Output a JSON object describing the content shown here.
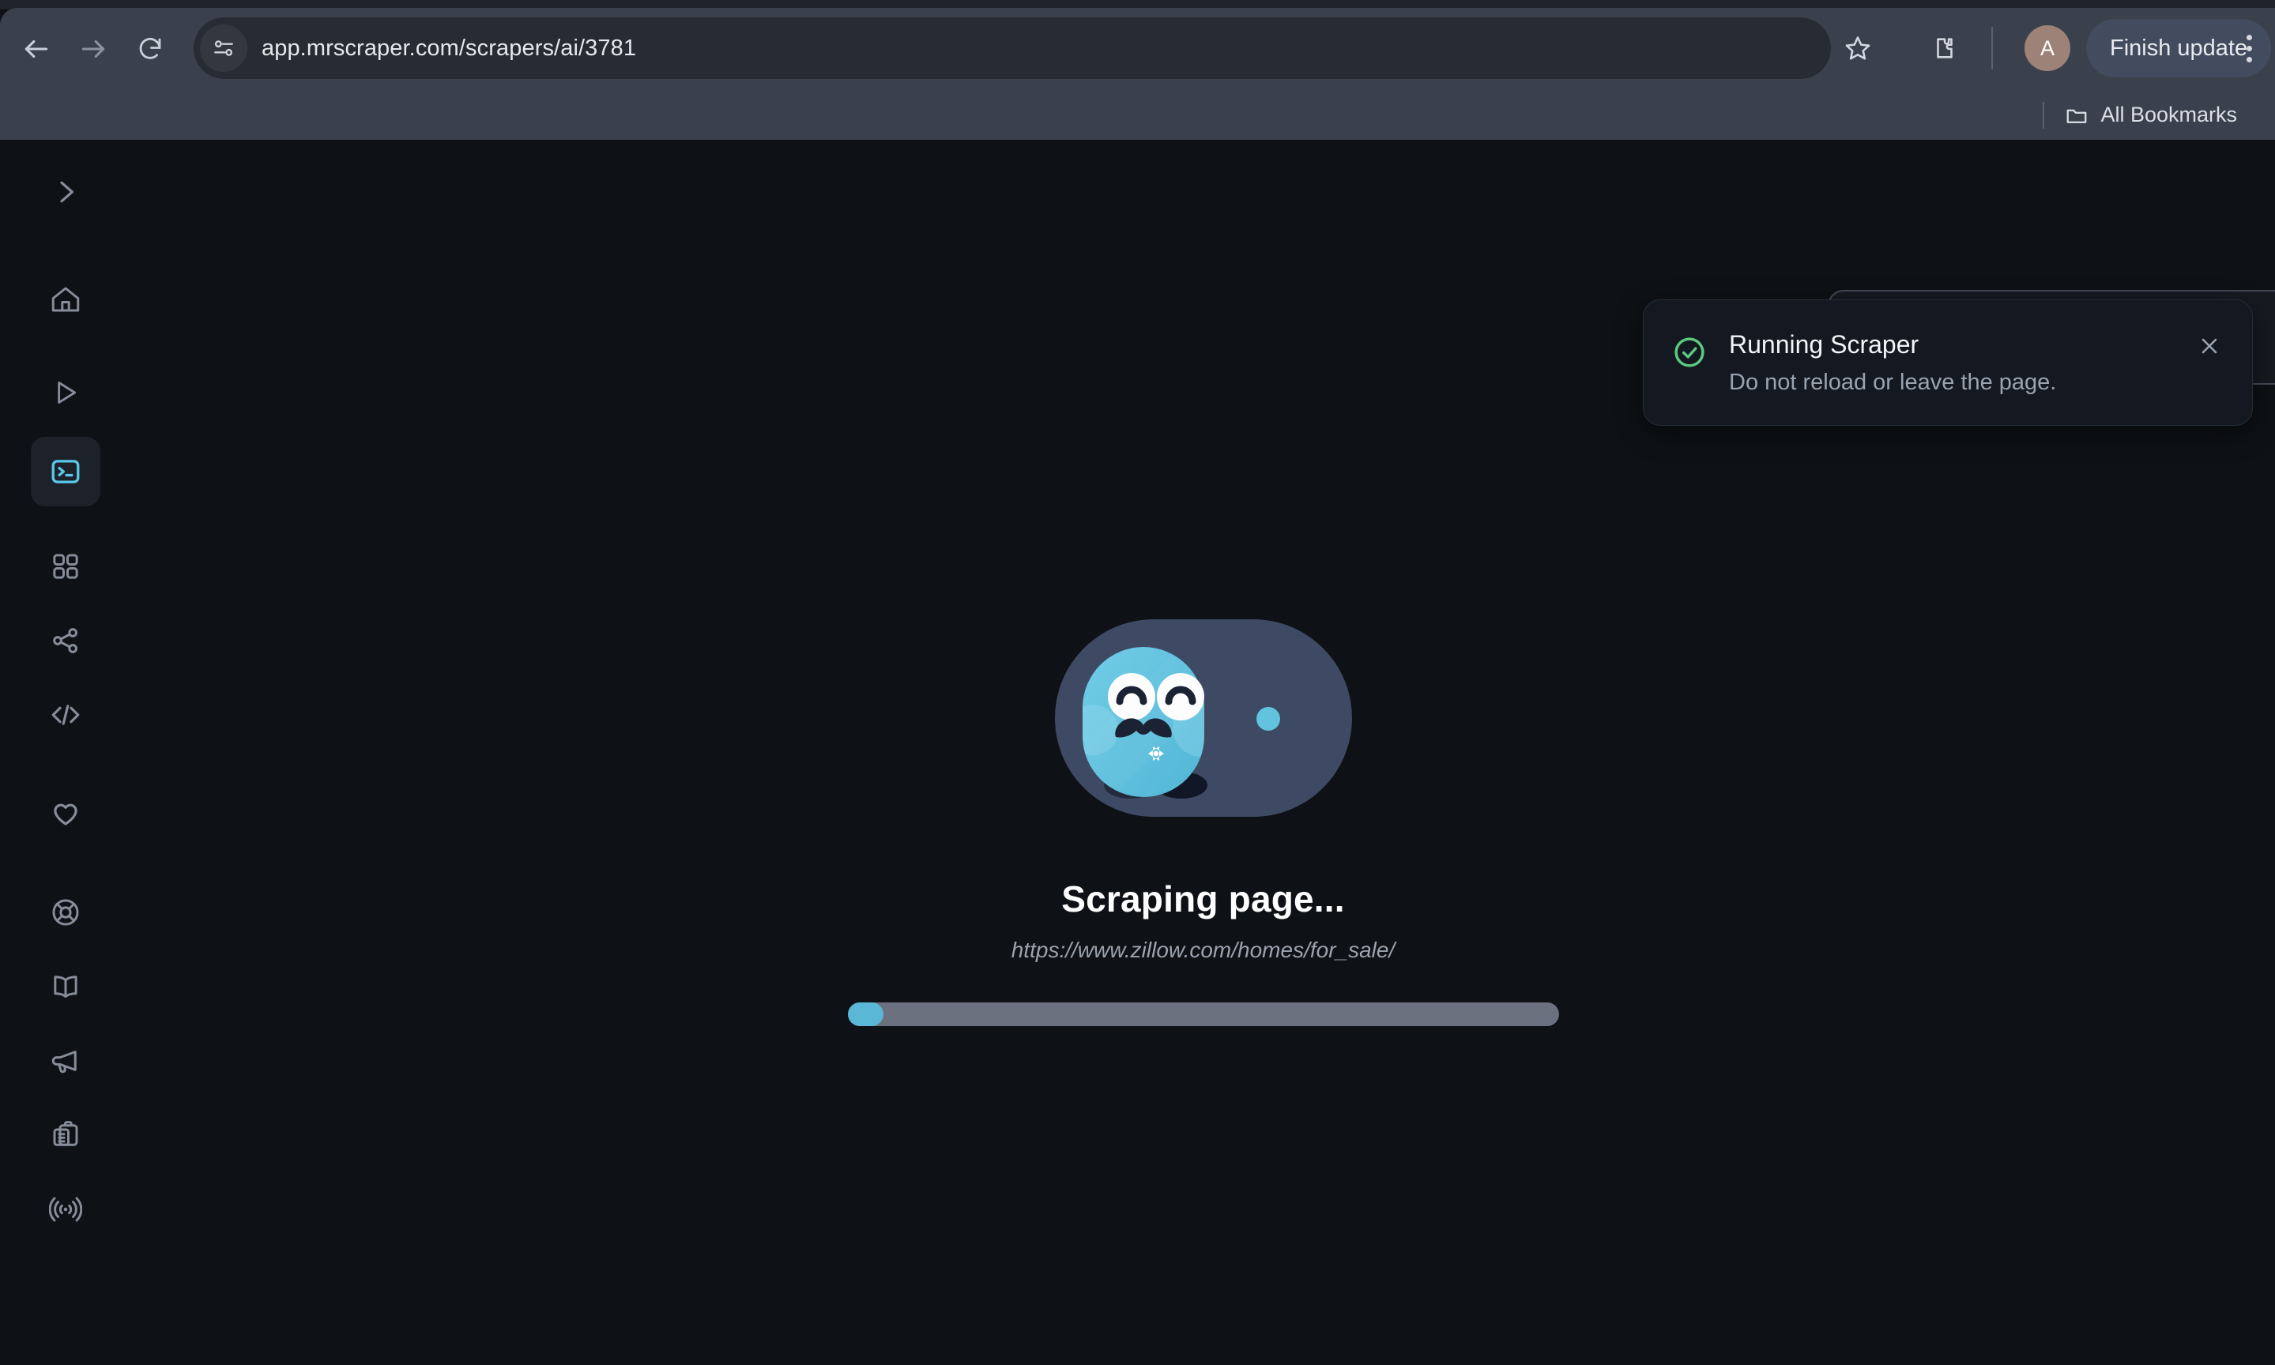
{
  "browser": {
    "url": "app.mrscraper.com/scrapers/ai/3781",
    "back_label": "Back",
    "forward_label": "Forward",
    "reload_label": "Reload",
    "site_info_label": "Site information",
    "bookmark_label": "Bookmark this tab",
    "extensions_label": "Extensions",
    "profile_initial": "A",
    "finish_update_label": "Finish update",
    "menu_label": "Customize and control Chrome",
    "bookmarks_label": "All Bookmarks"
  },
  "sidebar": {
    "items": [
      {
        "name": "collapse-expand",
        "icon": "chevron-right-icon",
        "active": false
      },
      {
        "name": "home",
        "icon": "home-icon",
        "active": false
      },
      {
        "name": "runs",
        "icon": "play-icon",
        "active": false
      },
      {
        "name": "scrapers",
        "icon": "terminal-icon",
        "active": true
      },
      {
        "name": "templates",
        "icon": "grid-icon",
        "active": false
      },
      {
        "name": "integrations",
        "icon": "share-icon",
        "active": false
      },
      {
        "name": "api",
        "icon": "code-icon",
        "active": false
      },
      {
        "name": "favorites",
        "icon": "heart-icon",
        "active": false
      },
      {
        "name": "support",
        "icon": "life-ring-icon",
        "active": false
      },
      {
        "name": "docs",
        "icon": "book-icon",
        "active": false
      },
      {
        "name": "announcements",
        "icon": "megaphone-icon",
        "active": false
      },
      {
        "name": "tasks",
        "icon": "clipboard-icon",
        "active": false
      },
      {
        "name": "status",
        "icon": "broadcast-icon",
        "active": false
      }
    ]
  },
  "main": {
    "title": "Scraping page...",
    "target_url": "https://www.zillow.com/homes/for_sale/",
    "progress_percent": 5,
    "mascot_alt": "mrscraper-mascot"
  },
  "toast": {
    "title": "Running Scraper",
    "body": "Do not reload or leave the page.",
    "status_icon": "check-circle-icon",
    "close_label": "Close notification"
  },
  "colors": {
    "accent": "#5bc8ea",
    "success": "#5cc97e",
    "page_bg": "#0e1115",
    "chrome_bg": "#3b414c",
    "progress_track": "#6b717e",
    "progress_fill": "#5bb7d6",
    "mascot_body": "#5fc4e0",
    "mascot_backdrop": "#3e4a63"
  }
}
